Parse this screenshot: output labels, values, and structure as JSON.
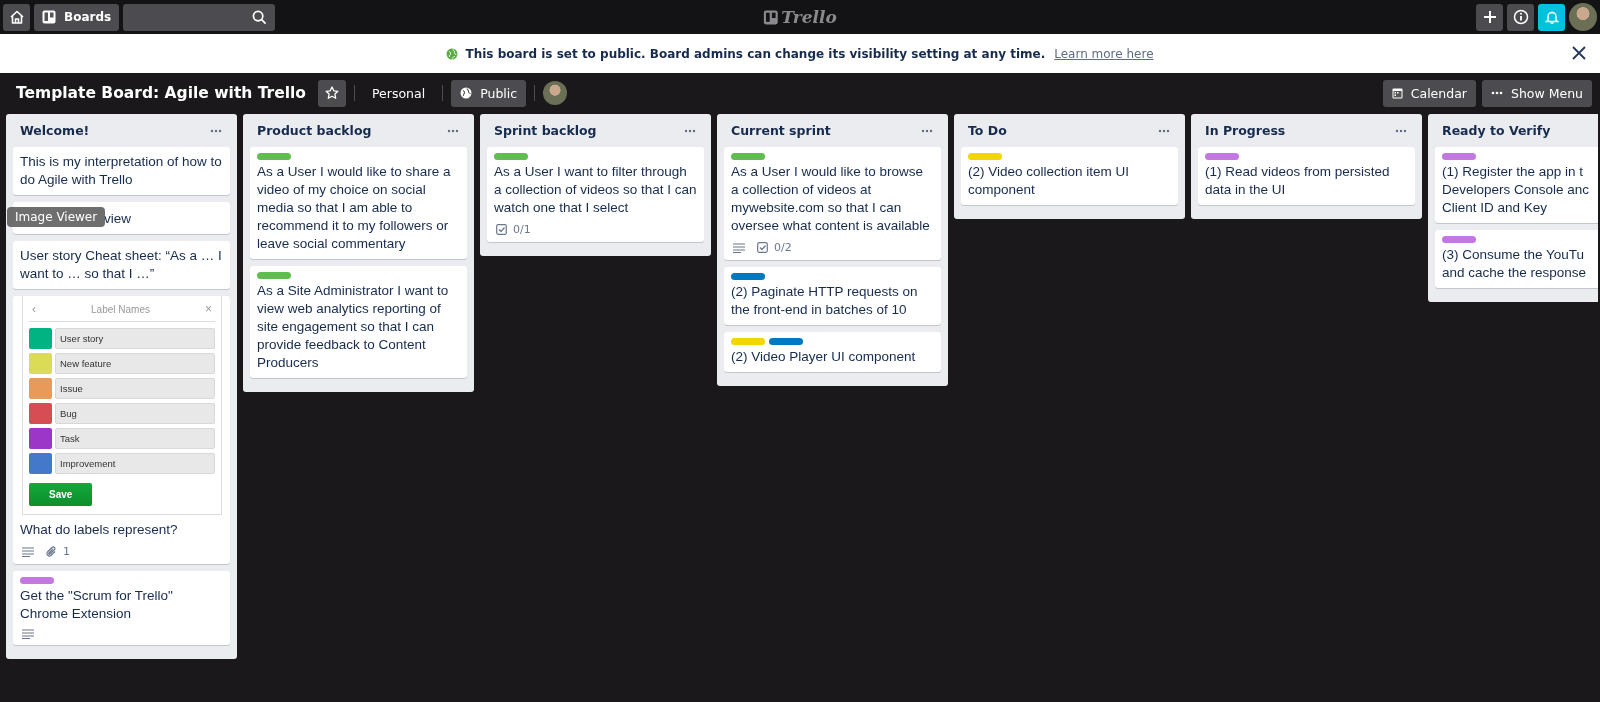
{
  "top_bar": {
    "boards_label": "Boards",
    "logo": "Trello"
  },
  "banner": {
    "message": "This board is set to public. Board admins can change its visibility setting at any time.",
    "link": "Learn more here"
  },
  "board_header": {
    "title": "Template Board: Agile with Trello",
    "starred": false,
    "team": "Personal",
    "visibility": "Public",
    "calendar": "Calendar",
    "menu": "Show Menu"
  },
  "lists": [
    {
      "title": "Welcome!",
      "cards": [
        {
          "text": "This is my interpretation of how to do Agile with Trello"
        },
        {
          "tooltip": "Image Viewer",
          "text": "view"
        },
        {
          "text": "User story Cheat sheet: “As a … I want to … so that I …”"
        },
        {
          "cover": {
            "back": "‹",
            "title": "Label Names",
            "close": "×",
            "labels": [
              {
                "name": "User story",
                "color": "#00b383"
              },
              {
                "name": "New feature",
                "color": "#dbdb57"
              },
              {
                "name": "Issue",
                "color": "#e89a5a"
              },
              {
                "name": "Bug",
                "color": "#d64e53"
              },
              {
                "name": "Task",
                "color": "#9c36c9"
              },
              {
                "name": "Improvement",
                "color": "#4478c8"
              }
            ],
            "save": "Save"
          },
          "text": "What do labels represent?",
          "badges": [
            {
              "kind": "description"
            },
            {
              "kind": "attachment",
              "text": "1"
            }
          ]
        },
        {
          "labels": [
            {
              "color": "#c377e0"
            }
          ],
          "text": "Get the \"Scrum for Trello\" Chrome Extension",
          "badges": [
            {
              "kind": "description"
            }
          ]
        }
      ]
    },
    {
      "title": "Product backlog",
      "cards": [
        {
          "labels": [
            {
              "color": "#61bd4f"
            }
          ],
          "text": "As a User I would like to share a video of my choice on social media so that I am able to recommend it to my followers or leave social commentary"
        },
        {
          "labels": [
            {
              "color": "#61bd4f"
            }
          ],
          "text": "As a Site Administrator I want to view web analytics reporting of site engagement so that I can provide feedback to Content Producers"
        }
      ]
    },
    {
      "title": "Sprint backlog",
      "cards": [
        {
          "labels": [
            {
              "color": "#61bd4f"
            }
          ],
          "text": "As a User I want to filter through a collection of videos so that I can watch one that I select",
          "badges": [
            {
              "kind": "checklist",
              "text": "0/1"
            }
          ]
        }
      ]
    },
    {
      "title": "Current sprint",
      "cards": [
        {
          "labels": [
            {
              "color": "#61bd4f"
            }
          ],
          "text": "As a User I would like to browse a collection of videos at mywebsite.com so that I can oversee what content is available",
          "badges": [
            {
              "kind": "description"
            },
            {
              "kind": "checklist",
              "text": "0/2"
            }
          ]
        },
        {
          "labels": [
            {
              "color": "#0079bf"
            }
          ],
          "text": "(2) Paginate HTTP requests on the front-end in batches of 10"
        },
        {
          "labels": [
            {
              "color": "#f2d600"
            },
            {
              "color": "#0079bf"
            }
          ],
          "text": "(2) Video Player UI component"
        }
      ]
    },
    {
      "title": "To Do",
      "cards": [
        {
          "labels": [
            {
              "color": "#f2d600"
            }
          ],
          "text": "(2) Video collection item UI component"
        }
      ]
    },
    {
      "title": "In Progress",
      "cards": [
        {
          "labels": [
            {
              "color": "#c377e0"
            }
          ],
          "text": "(1) Read videos from persisted data in the UI"
        }
      ]
    },
    {
      "title": "Ready to Verify",
      "cards": [
        {
          "labels": [
            {
              "color": "#c377e0"
            }
          ],
          "lines": [
            "(1) Register the app in t",
            "Developers Console anc",
            "Client ID and Key"
          ]
        },
        {
          "labels": [
            {
              "color": "#c377e0"
            }
          ],
          "lines": [
            "(3) Consume the YouTu",
            "and cache the response"
          ]
        }
      ]
    }
  ]
}
